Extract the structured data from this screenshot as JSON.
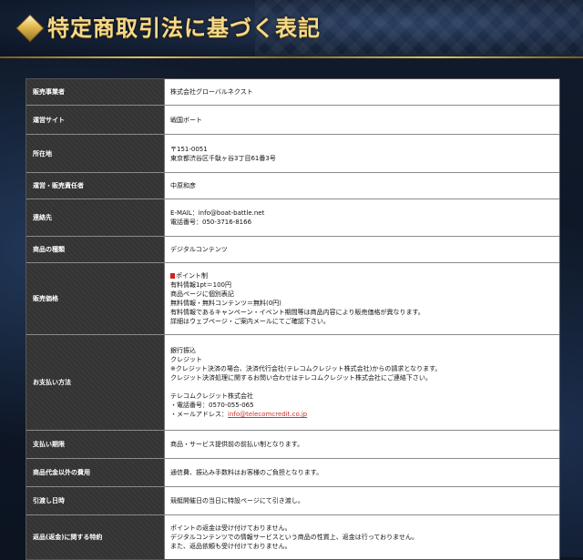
{
  "header": {
    "title": "特定商取引法に基づく表記"
  },
  "rows": [
    {
      "label": "販売事業者",
      "lines": [
        "株式会社グローバルネクスト"
      ]
    },
    {
      "label": "運営サイト",
      "lines": [
        "戦国ボート"
      ]
    },
    {
      "label": "所在地",
      "lines": [
        "〒151-0051",
        "東京都渋谷区千駄ヶ谷3丁目61番3号"
      ]
    },
    {
      "label": "運営・販売責任者",
      "lines": [
        "中原和彦"
      ]
    },
    {
      "label": "連絡先",
      "lines": [
        "E-MAIL：info@boat-battle.net",
        "電話番号：050-3716-8166"
      ]
    },
    {
      "label": "商品の種類",
      "lines": [
        "デジタルコンテンツ"
      ]
    },
    {
      "label": "販売価格",
      "lines": [
        "ポイント制",
        "有料情報1pt＝100円",
        "商品ページに個別表記",
        "無料情報・無料コンテンツ＝無料(0円)",
        "有料情報であるキャンペーン・イベント期間等は商品内容により販売価格が異なります。",
        "詳細はウェブページ・ご案内メールにてご確認下さい。"
      ]
    },
    {
      "label": "お支払い方法",
      "lines": [
        "銀行振込",
        "クレジット",
        "※クレジット決済の場合、決済代行会社(テレコムクレジット株式会社)からの請求となります。",
        "クレジット決済処理に関するお問い合わせはテレコムクレジット株式会社にご連絡下さい。",
        "",
        "テレコムクレジット株式会社",
        "・電話番号：0570-055-065"
      ],
      "mail_prefix": "・メールアドレス：",
      "mail_link": "info@telecomcredit.co.jp"
    },
    {
      "label": "支払い期限",
      "lines": [
        "商品・サービス提供前の前払い制となります。"
      ]
    },
    {
      "label": "商品代金以外の費用",
      "lines": [
        "通信費、振込み手数料はお客様のご負担となります。"
      ]
    },
    {
      "label": "引渡し日時",
      "lines": [
        "競艇開催日の当日に特設ページにて引き渡し。"
      ]
    },
    {
      "label": "返品(返金)に関する特約",
      "lines": [
        "ポイントの返金は受け付けておりません。",
        "デジタルコンテンツでの情報サービスという商品の性質上、返金は行っておりません。",
        "また、返品依頼も受け付けておりません。"
      ]
    }
  ]
}
